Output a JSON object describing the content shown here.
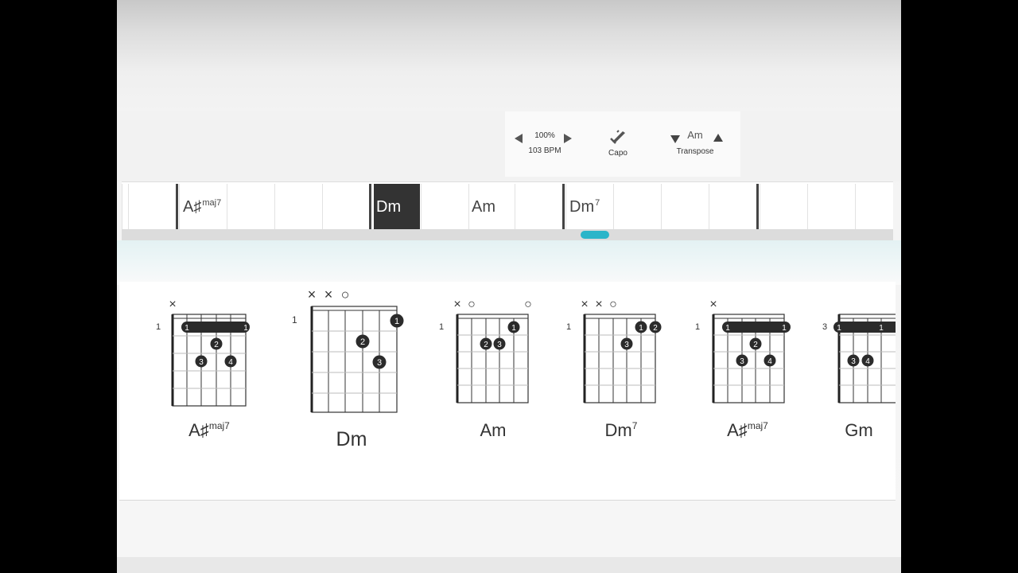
{
  "controls": {
    "speed": "100%",
    "bpm": "103 BPM",
    "capo_label": "Capo",
    "transpose_key": "Am",
    "transpose_label": "Transpose"
  },
  "timeline": {
    "chords": [
      {
        "root": "A♯",
        "ext": "maj7"
      },
      {
        "root": "Dm",
        "ext": "",
        "active": true
      },
      {
        "root": "Am",
        "ext": ""
      },
      {
        "root": "Dm",
        "ext": "7"
      }
    ]
  },
  "diagrams": [
    {
      "name_root": "A♯",
      "name_ext": "maj7",
      "fret": "1",
      "markers": [
        "×",
        "",
        "",
        "",
        "",
        ""
      ],
      "barre_label_left": "1",
      "barre_label_right": "1",
      "dots": [
        {
          "label": "2"
        },
        {
          "label": "3"
        },
        {
          "label": "4"
        }
      ]
    },
    {
      "name_root": "Dm",
      "name_ext": "",
      "fret": "1",
      "markers": [
        "×",
        "×",
        "○",
        "",
        "",
        ""
      ],
      "dots": [
        {
          "label": "1"
        },
        {
          "label": "2"
        },
        {
          "label": "3"
        }
      ]
    },
    {
      "name_root": "Am",
      "name_ext": "",
      "fret": "1",
      "markers": [
        "×",
        "○",
        "",
        "",
        "",
        "○"
      ],
      "dots": [
        {
          "label": "1"
        },
        {
          "label": "2"
        },
        {
          "label": "3"
        }
      ]
    },
    {
      "name_root": "Dm",
      "name_ext": "7",
      "fret": "1",
      "markers": [
        "×",
        "×",
        "○",
        "",
        "",
        ""
      ],
      "dots": [
        {
          "label": "1"
        },
        {
          "label": "2"
        },
        {
          "label": "3"
        }
      ]
    },
    {
      "name_root": "A♯",
      "name_ext": "maj7",
      "fret": "1",
      "markers": [
        "×",
        "",
        "",
        "",
        "",
        ""
      ],
      "barre_label_left": "1",
      "barre_label_right": "1",
      "dots": [
        {
          "label": "2"
        },
        {
          "label": "3"
        },
        {
          "label": "4"
        }
      ]
    },
    {
      "name_root": "Gm",
      "name_ext": "",
      "fret": "3",
      "markers": [
        "",
        "",
        "",
        "",
        "",
        ""
      ],
      "barre_label_left": "1",
      "barre_label_right": "1",
      "dots": [
        {
          "label": "3"
        },
        {
          "label": "4"
        }
      ]
    }
  ]
}
